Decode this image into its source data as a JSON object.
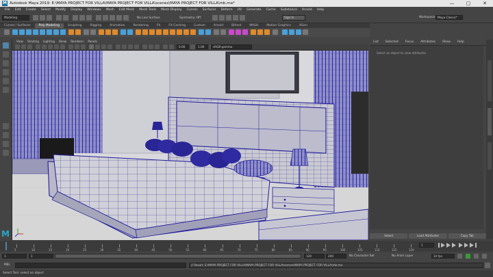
{
  "window": {
    "title": "Autodesk Maya 2019: E:\\MAYA PROJECT FOR VILLA\\MAYA PROJECT FOR VILLA\\scenes\\MAYA PROJECT FOR VILLA\\mb.ma*",
    "logo": "M",
    "controls": [
      "—",
      "▢",
      "✕"
    ]
  },
  "menubar": [
    "File",
    "Edit",
    "Create",
    "Select",
    "Modify",
    "Display",
    "Windows",
    "Mesh",
    "Edit Mesh",
    "Mesh Tools",
    "Mesh Display",
    "Curves",
    "Surfaces",
    "Deform",
    "UV",
    "Generate",
    "Cache",
    "Substance",
    "Arnold",
    "Help"
  ],
  "statusline": {
    "mode": "Modeling",
    "live_surface": "No Live Surface",
    "symmetry": "Symmetry: Off",
    "sign_in": "Sign In",
    "workspace_label": "Workspace:",
    "workspace": "Maya Classic*"
  },
  "shelf_tabs": [
    "Curves / Surfaces",
    "Poly Modeling",
    "Sculpting",
    "Rigging",
    "Animation",
    "Rendering",
    "FX",
    "FX Caching",
    "Custom",
    "Arnold",
    "Bifrost",
    "MASH",
    "Motion Graphics",
    "XGen"
  ],
  "shelf_active": 1,
  "panel_menu": [
    "View",
    "Shading",
    "Lighting",
    "Show",
    "Renderer",
    "Panels"
  ],
  "panel_tools": {
    "value1": "0.00",
    "value2": "1.00",
    "colorspace": "sRGB gamma"
  },
  "right_panel": {
    "tabs": [
      "List",
      "Selected",
      "Focus",
      "Attributes",
      "Show",
      "Help"
    ],
    "message": "Select an object to view attributes",
    "buttons": [
      "Select",
      "Load Attributes",
      "Copy Tab"
    ],
    "side_tabs": [
      "Channel Box / Layer Editor",
      "Attribute Editor",
      "Modeling Toolkit"
    ]
  },
  "timeline": {
    "ticks": [
      "5",
      "10",
      "15",
      "20",
      "25",
      "30",
      "35",
      "40",
      "45",
      "50",
      "55",
      "60",
      "65",
      "70",
      "75",
      "80",
      "85",
      "90",
      "95",
      "100",
      "105",
      "110",
      "115",
      "120"
    ],
    "current_frame": "1"
  },
  "range": {
    "start": "1",
    "inner_start": "1",
    "inner_end": "120",
    "end": "120",
    "end2": "200",
    "character_set": "No Character Set",
    "anim_layer": "No Anim Layer",
    "fps": "24 fps"
  },
  "command_line": {
    "lang": "MEL",
    "result": "// Result: E:\\MAYA PROJECT FOR VILLA\\MAYA PROJECT FOR VILLA\\scenes\\MAYA PROJECT FOR VILLA\\mb.ma"
  },
  "help_line": "Select Tool: select an object",
  "colors": {
    "wire": "#1f1a9c",
    "accent": "#5285a6",
    "maya_logo": "#23a9c9"
  }
}
